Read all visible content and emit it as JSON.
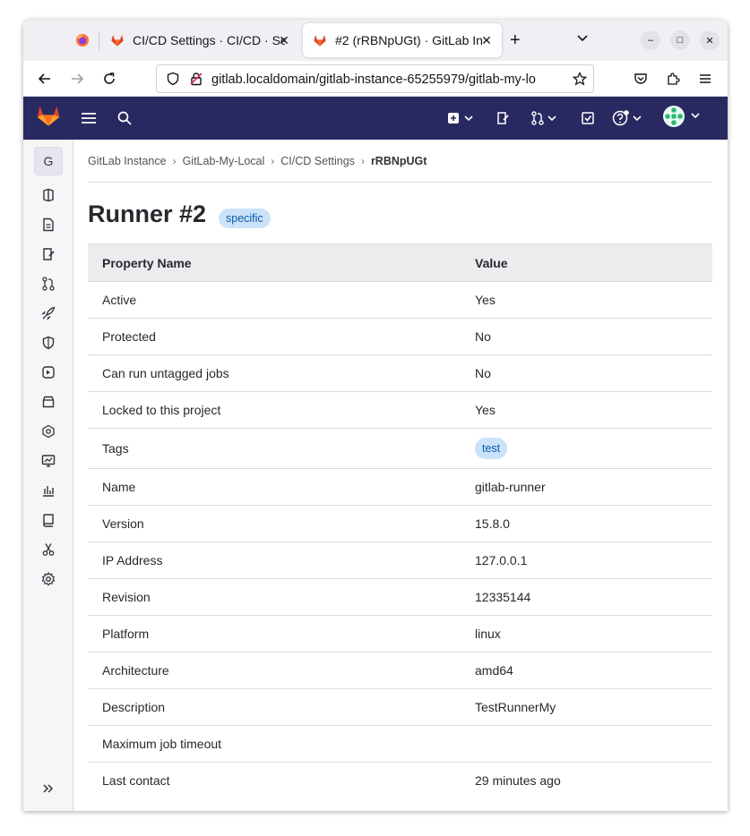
{
  "browser": {
    "tabs": [
      {
        "title": "CI/CD Settings · CI/CD · Se",
        "active": false
      },
      {
        "title": "#2 (rRBNpUGt) · GitLab In",
        "active": true
      }
    ],
    "url": "gitlab.localdomain/gitlab-instance-65255979/gitlab-my-lo"
  },
  "sidebar": {
    "project_initial": "G",
    "items": [
      "project-overview",
      "repository",
      "issues",
      "merge-requests",
      "ci-cd",
      "security",
      "deployments",
      "packages",
      "infrastructure",
      "monitor",
      "analytics",
      "wiki",
      "snippets",
      "settings"
    ]
  },
  "breadcrumb": [
    "GitLab Instance",
    "GitLab-My-Local",
    "CI/CD Settings",
    "rRBNpUGt"
  ],
  "page": {
    "title": "Runner #2",
    "badge": "specific"
  },
  "table": {
    "headers": [
      "Property Name",
      "Value"
    ],
    "rows": [
      {
        "name": "Active",
        "value": "Yes"
      },
      {
        "name": "Protected",
        "value": "No"
      },
      {
        "name": "Can run untagged jobs",
        "value": "No"
      },
      {
        "name": "Locked to this project",
        "value": "Yes"
      },
      {
        "name": "Tags",
        "value": "test"
      },
      {
        "name": "Name",
        "value": "gitlab-runner"
      },
      {
        "name": "Version",
        "value": "15.8.0"
      },
      {
        "name": "IP Address",
        "value": "127.0.0.1"
      },
      {
        "name": "Revision",
        "value": "12335144"
      },
      {
        "name": "Platform",
        "value": "linux"
      },
      {
        "name": "Architecture",
        "value": "amd64"
      },
      {
        "name": "Description",
        "value": "TestRunnerMy"
      },
      {
        "name": "Maximum job timeout",
        "value": ""
      },
      {
        "name": "Last contact",
        "value": "29 minutes ago"
      }
    ]
  },
  "colors": {
    "gitlab_header": "#292961",
    "badge_bg": "#cbe2f9",
    "badge_text": "#0b5cad"
  }
}
